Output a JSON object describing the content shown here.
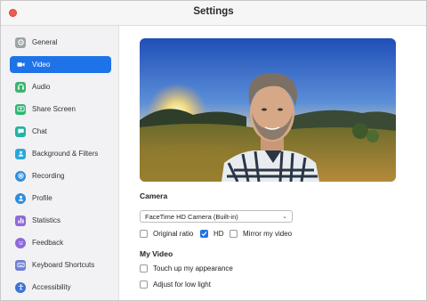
{
  "window": {
    "title": "Settings"
  },
  "sidebar": {
    "items": [
      {
        "label": "General",
        "icon": "gear-icon",
        "color": "#9ea3a8",
        "active": false
      },
      {
        "label": "Video",
        "icon": "video-camera-icon",
        "color": "#1f73e8",
        "active": true
      },
      {
        "label": "Audio",
        "icon": "headphones-icon",
        "color": "#3cb371",
        "active": false
      },
      {
        "label": "Share Screen",
        "icon": "share-screen-icon",
        "color": "#2eb872",
        "active": false
      },
      {
        "label": "Chat",
        "icon": "chat-bubble-icon",
        "color": "#22b3a3",
        "active": false
      },
      {
        "label": "Background & Filters",
        "icon": "background-person-icon",
        "color": "#29a9d9",
        "active": false
      },
      {
        "label": "Recording",
        "icon": "record-icon",
        "color": "#2d8ee0",
        "active": false
      },
      {
        "label": "Profile",
        "icon": "profile-icon",
        "color": "#2d8ee0",
        "active": false
      },
      {
        "label": "Statistics",
        "icon": "statistics-icon",
        "color": "#8e6ad8",
        "active": false
      },
      {
        "label": "Feedback",
        "icon": "feedback-smiley-icon",
        "color": "#8e6ad8",
        "active": false
      },
      {
        "label": "Keyboard Shortcuts",
        "icon": "keyboard-icon",
        "color": "#6f7fd8",
        "active": false
      },
      {
        "label": "Accessibility",
        "icon": "accessibility-icon",
        "color": "#3d72d6",
        "active": false
      }
    ]
  },
  "camera": {
    "heading": "Camera",
    "selected": "FaceTime HD Camera (Built-in)",
    "options": [
      {
        "label": "Original ratio",
        "checked": false
      },
      {
        "label": "HD",
        "checked": true
      },
      {
        "label": "Mirror my video",
        "checked": false
      }
    ]
  },
  "my_video": {
    "heading": "My Video",
    "options": [
      {
        "label": "Touch up my appearance",
        "checked": false
      },
      {
        "label": "Adjust for low light",
        "checked": false
      }
    ]
  },
  "colors": {
    "accent": "#1f73e8",
    "close": "#ee5c52"
  }
}
